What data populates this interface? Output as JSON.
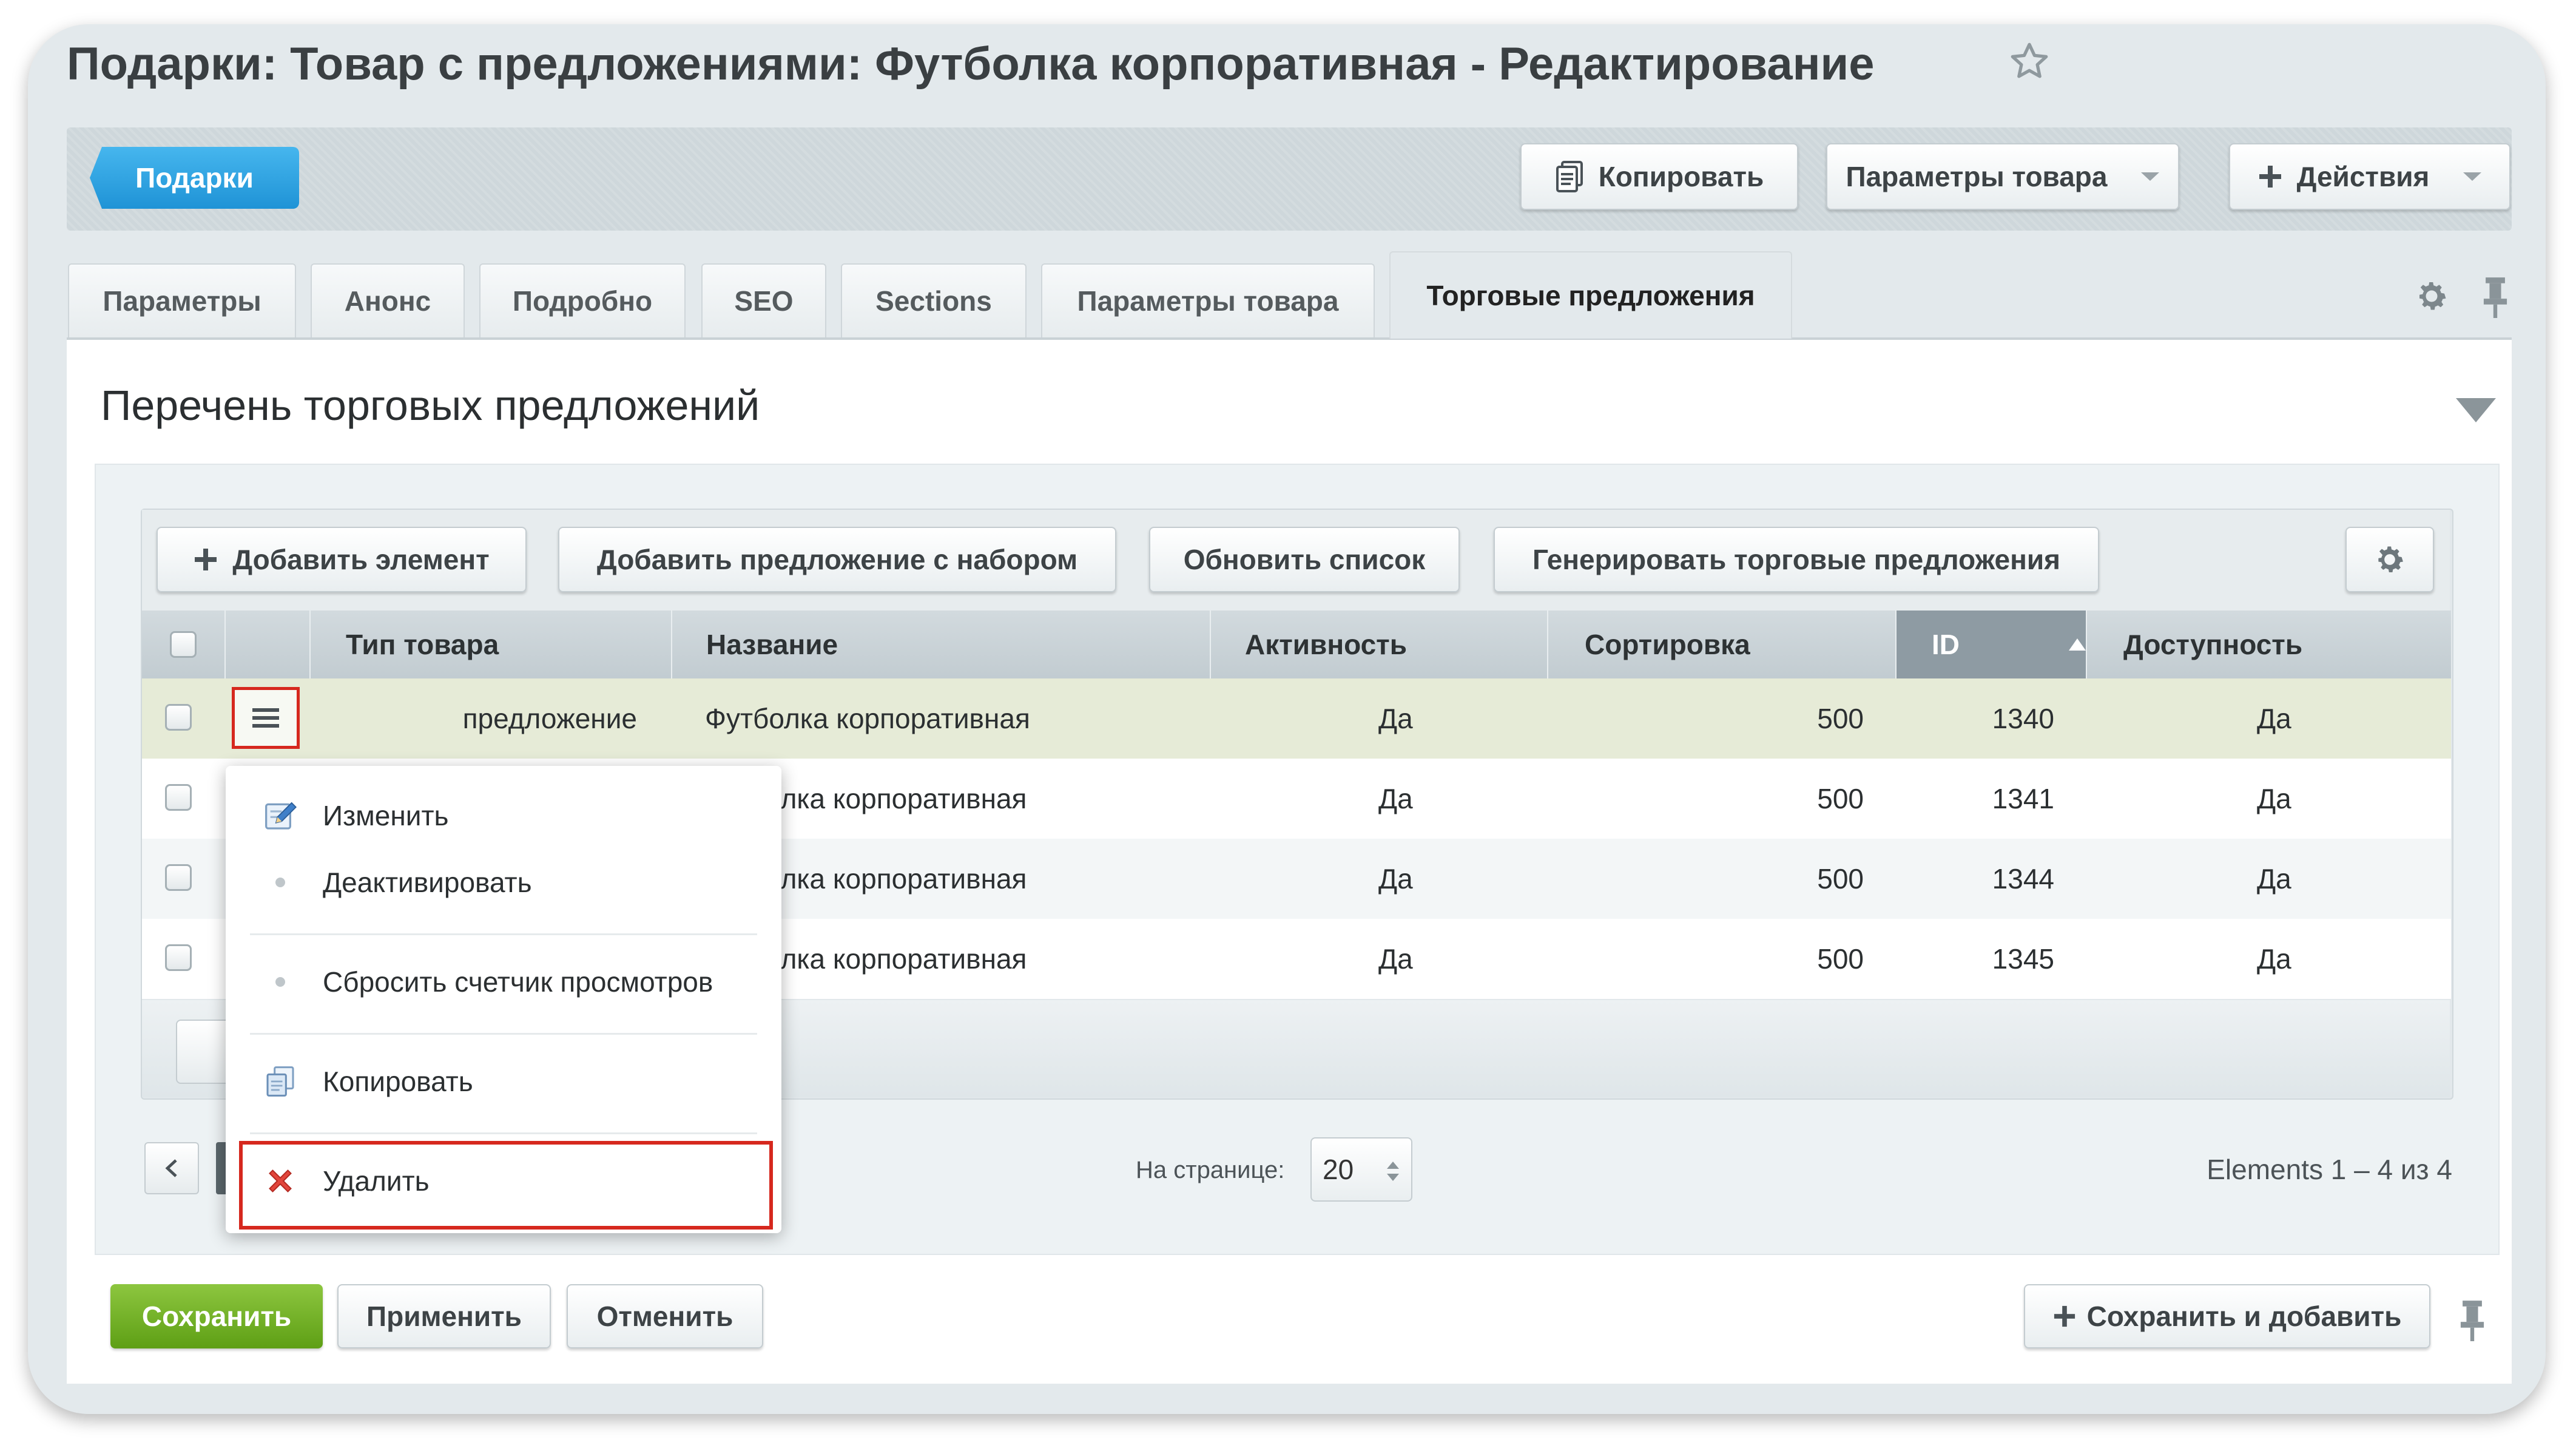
{
  "page": {
    "title": "Подарки: Товар с предложениями: Футболка корпоративная - Редактирование"
  },
  "toolbar": {
    "breadcrumb": "Подарки",
    "copy": "Копировать",
    "product_params": "Параметры товара",
    "actions": "Действия"
  },
  "tabs": [
    {
      "label": "Параметры"
    },
    {
      "label": "Анонс"
    },
    {
      "label": "Подробно"
    },
    {
      "label": "SEO"
    },
    {
      "label": "Sections"
    },
    {
      "label": "Параметры товара"
    },
    {
      "label": "Торговые предложения",
      "active": true
    }
  ],
  "section": {
    "title": "Перечень торговых предложений"
  },
  "grid": {
    "buttons": {
      "add_element": "Добавить элемент",
      "add_offer_set": "Добавить предложение с набором",
      "refresh": "Обновить список",
      "generate": "Генерировать торговые предложения"
    },
    "columns": [
      "Тип товара",
      "Название",
      "Активность",
      "Сортировка",
      "ID",
      "Доступность"
    ],
    "sorted_column": "ID",
    "rows": [
      {
        "type": "предложение",
        "name": "Футболка корпоративная",
        "active": "Да",
        "sort": "500",
        "id": "1340",
        "avail": "Да"
      },
      {
        "type": "",
        "name": "олка корпоративная",
        "active": "Да",
        "sort": "500",
        "id": "1341",
        "avail": "Да"
      },
      {
        "type": "",
        "name": "олка корпоративная",
        "active": "Да",
        "sort": "500",
        "id": "1344",
        "avail": "Да"
      },
      {
        "type": "",
        "name": "олка корпоративная",
        "active": "Да",
        "sort": "500",
        "id": "1345",
        "avail": "Да"
      }
    ]
  },
  "context_menu": {
    "edit": "Изменить",
    "deactivate": "Деактивировать",
    "reset_counter": "Сбросить счетчик просмотров",
    "copy": "Копировать",
    "delete": "Удалить"
  },
  "pager": {
    "per_page_label": "На странице:",
    "per_page_value": "20",
    "count_text": "Elements 1 – 4 из 4"
  },
  "footer": {
    "save": "Сохранить",
    "apply": "Применить",
    "cancel": "Отменить",
    "save_add": "Сохранить и добавить"
  },
  "colors": {
    "accent_blue": "#2fa6e3",
    "save_green": "#6fae22",
    "highlight_red": "#d6281e",
    "selected_row": "#e6ebd7"
  }
}
